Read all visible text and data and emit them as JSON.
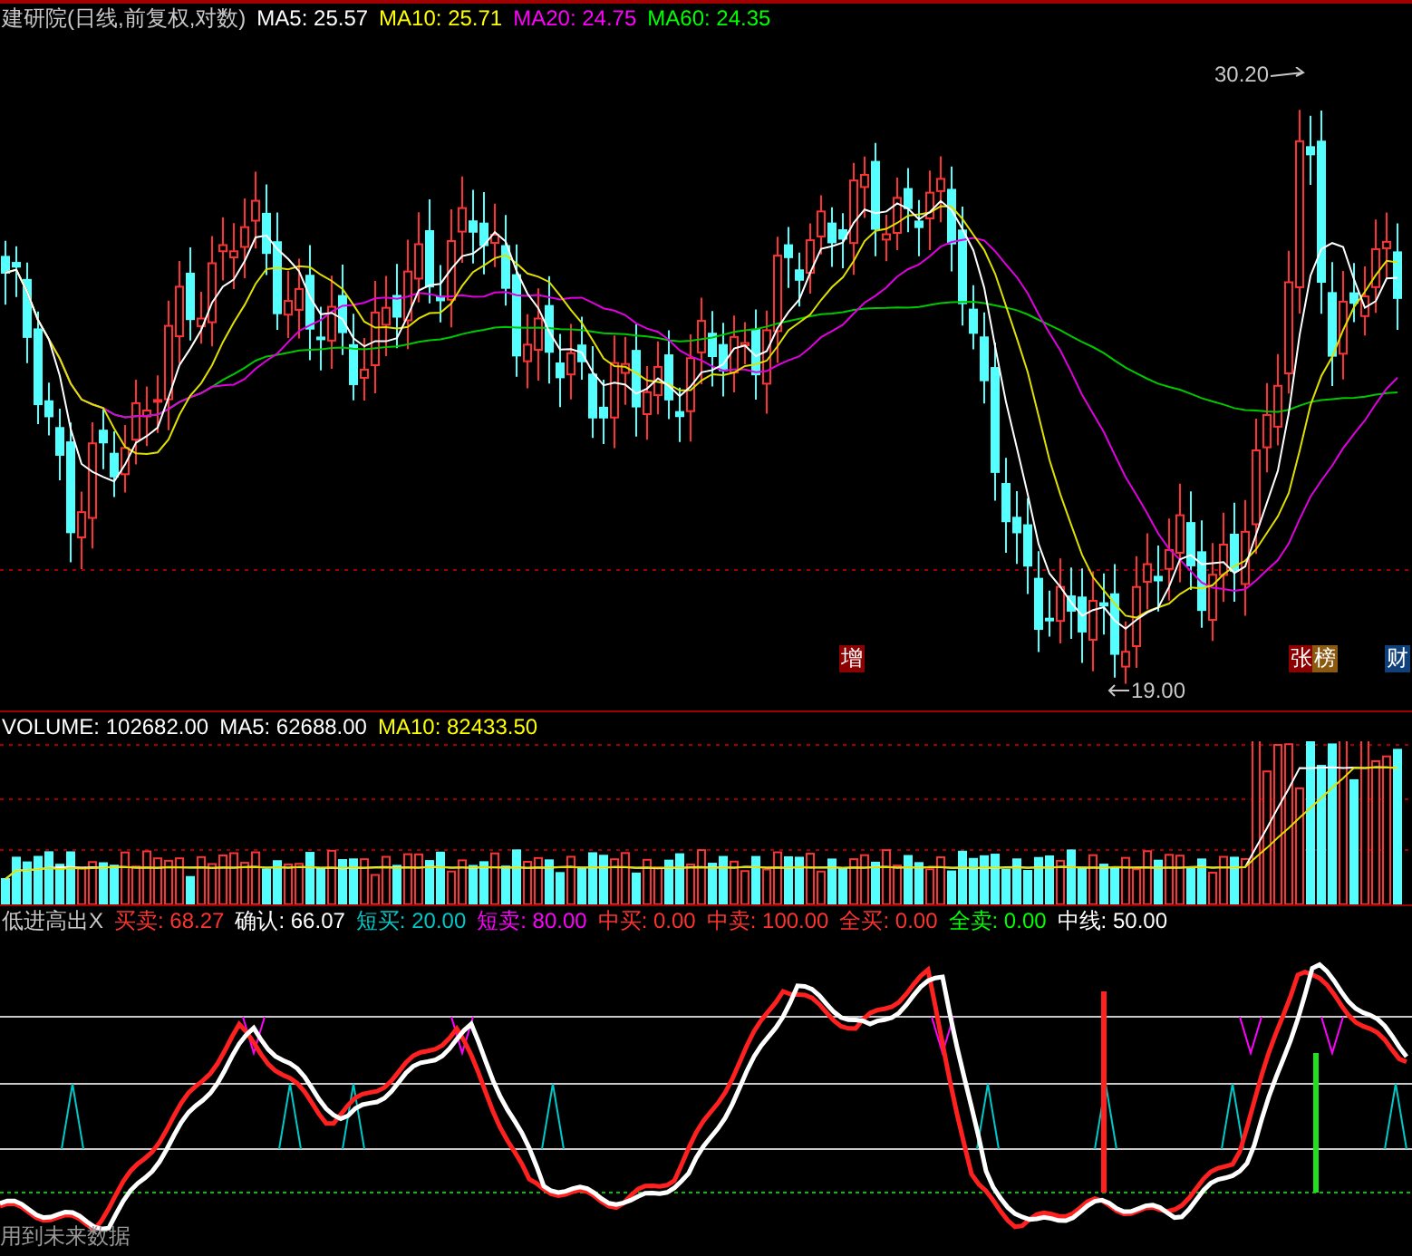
{
  "main": {
    "title": "建研院(日线,前复权,对数)",
    "indicators": [
      {
        "label": "MA5: 25.57",
        "color": "#ffffff"
      },
      {
        "label": "MA10: 25.71",
        "color": "#ffff00"
      },
      {
        "label": "MA20: 24.75",
        "color": "#ff00ff"
      },
      {
        "label": "MA60: 24.35",
        "color": "#00ff00"
      }
    ],
    "high_label": "30.20",
    "low_label": "19.00",
    "badges": [
      {
        "text": "增",
        "color": "#8b0000"
      },
      {
        "text": "张",
        "color": "#8b0000"
      },
      {
        "text": "榜",
        "color": "#8b5a10"
      },
      {
        "text": "财",
        "color": "#10407a"
      }
    ]
  },
  "volume": {
    "label": "VOLUME: 102682.00",
    "indicators": [
      {
        "label": "MA5: 62688.00",
        "color": "#ffffff"
      },
      {
        "label": "MA10: 82433.50",
        "color": "#ffff00"
      }
    ]
  },
  "indicator": {
    "name": "低进高出X",
    "values": [
      {
        "label": "买卖: 68.27",
        "color": "#ff3232"
      },
      {
        "label": "确认: 66.07",
        "color": "#ffffff"
      },
      {
        "label": "短买: 20.00",
        "color": "#00c8c8"
      },
      {
        "label": "短卖: 80.00",
        "color": "#ff00ff"
      },
      {
        "label": "中买: 0.00",
        "color": "#ff3232"
      },
      {
        "label": "中卖: 100.00",
        "color": "#ff3232"
      },
      {
        "label": "全买: 0.00",
        "color": "#ff3232"
      },
      {
        "label": "全卖: 0.00",
        "color": "#00ff00"
      },
      {
        "label": "中线: 50.00",
        "color": "#ffffff"
      }
    ],
    "note": "用到未来数据"
  }
}
